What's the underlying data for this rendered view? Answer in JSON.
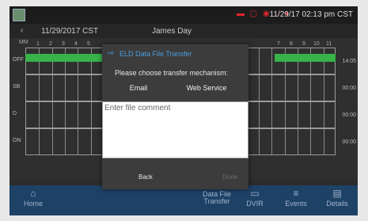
{
  "status_bar": {
    "time": "11/29/17 02:13 pm CST"
  },
  "header": {
    "back_icon": "chevron-left-icon",
    "date": "11/29/2017 CST",
    "driver": "James Day"
  },
  "grid": {
    "hours_left": [
      "MM",
      "1",
      "2",
      "3",
      "4",
      "5"
    ],
    "hours_right": [
      "7",
      "8",
      "9",
      "10",
      "11"
    ],
    "rows": [
      {
        "label": "OFF",
        "total": "14:05"
      },
      {
        "label": "SB",
        "total": "00:00"
      },
      {
        "label": "D",
        "total": "00:00"
      },
      {
        "label": "ON",
        "total": "00:00"
      }
    ]
  },
  "dialog": {
    "title": "ELD Data File Transfer",
    "title_icon": "export-icon",
    "prompt": "Please choose transfer mechanism:",
    "email_label": "Email",
    "webservice_label": "Web Service",
    "comment_placeholder": "Enter file comment",
    "comment_value": "",
    "back_label": "Back",
    "done_label": "Done"
  },
  "nav": [
    {
      "label": "Home",
      "icon": "home-icon"
    },
    {
      "label": "Data File Transfer",
      "icon": ""
    },
    {
      "label": "DVIR",
      "icon": "truck-icon"
    },
    {
      "label": "Events",
      "icon": "list-icon"
    },
    {
      "label": "Details",
      "icon": "document-icon"
    }
  ],
  "colors": {
    "accent": "#4a9fe0",
    "nav_bg": "#1e4166",
    "duty_off": "#37b34a",
    "alert": "#e2262b"
  }
}
